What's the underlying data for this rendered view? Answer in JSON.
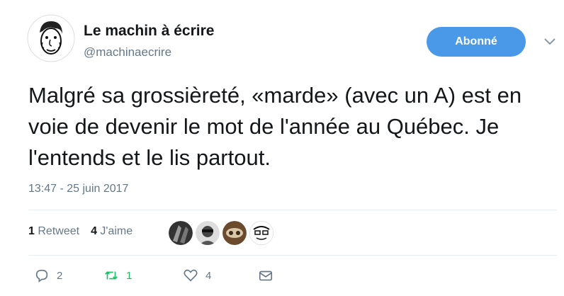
{
  "tweet": {
    "author_name": "Le machin à écrire",
    "author_handle": "@machinaecrire",
    "follow_label": "Abonné",
    "text": "Malgré sa grossièreté, «marde» (avec un A) est en voie de devenir le mot de l'année au Québec. Je l'entends et le lis partout.",
    "timestamp": "13:47 - 25 juin 2017"
  },
  "stats": {
    "retweets_count": "1",
    "retweets_label": "Retweet",
    "likes_count": "4",
    "likes_label": "J'aime"
  },
  "actions": {
    "reply_count": "2",
    "retweet_count": "1",
    "like_count": "4"
  },
  "colors": {
    "accent": "#4a99e9",
    "retweet": "#17bf63",
    "muted": "#657786"
  },
  "icons": [
    "avatar-caricature",
    "chevron-down-icon",
    "reply-icon",
    "retweet-icon",
    "heart-icon",
    "envelope-icon"
  ]
}
